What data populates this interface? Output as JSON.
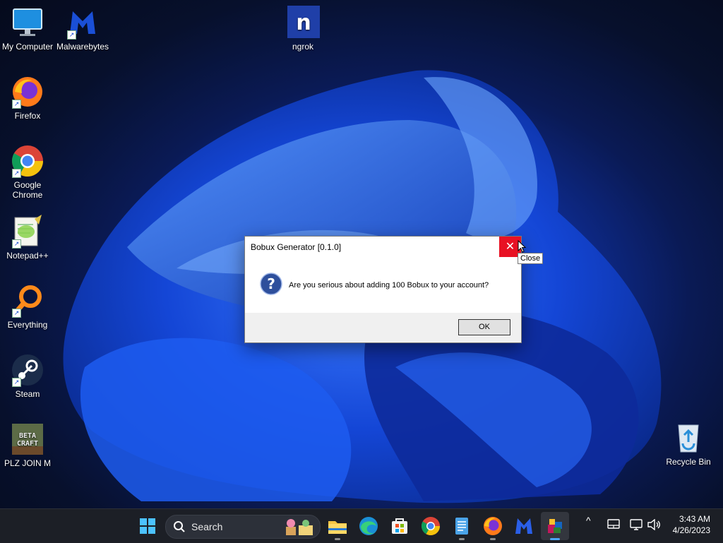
{
  "desktop": {
    "icons": [
      {
        "label": "My Computer",
        "icon": "monitor-icon"
      },
      {
        "label": "Malwarebytes",
        "icon": "malwarebytes-icon"
      },
      {
        "label": "ngrok",
        "icon": "ngrok-icon"
      },
      {
        "label": "Firefox",
        "icon": "firefox-icon"
      },
      {
        "label": "Google Chrome",
        "icon": "chrome-icon"
      },
      {
        "label": "Notepad++",
        "icon": "notepadpp-icon"
      },
      {
        "label": "Everything",
        "icon": "search-icon"
      },
      {
        "label": "Steam",
        "icon": "steam-icon"
      },
      {
        "label": "PLZ JOIN M",
        "icon": "betacraft-icon"
      },
      {
        "label": "Recycle Bin",
        "icon": "recycle-bin-icon"
      }
    ],
    "ngrok_glyph": "n",
    "betacraft_logo": "BETA CRAFT"
  },
  "dialog": {
    "title": "Bobux Generator [0.1.0]",
    "close_glyph": "✕",
    "message": "Are you serious about adding 100 Bobux to your account?",
    "ok_label": "OK",
    "tooltip": "Close"
  },
  "taskbar": {
    "search_label": "Search",
    "apps": [
      "start-icon",
      "file-explorer-icon",
      "edge-icon",
      "store-icon",
      "chrome-icon",
      "notepad-icon",
      "firefox-icon",
      "malwarebytes-icon",
      "bobux-generator-icon"
    ],
    "chevron": "^",
    "time": "3:43 AM",
    "date": "4/26/2023"
  },
  "colors": {
    "close_red": "#e81123",
    "taskbar": "#1c1f26",
    "accent_blue": "#4ba6f7"
  }
}
